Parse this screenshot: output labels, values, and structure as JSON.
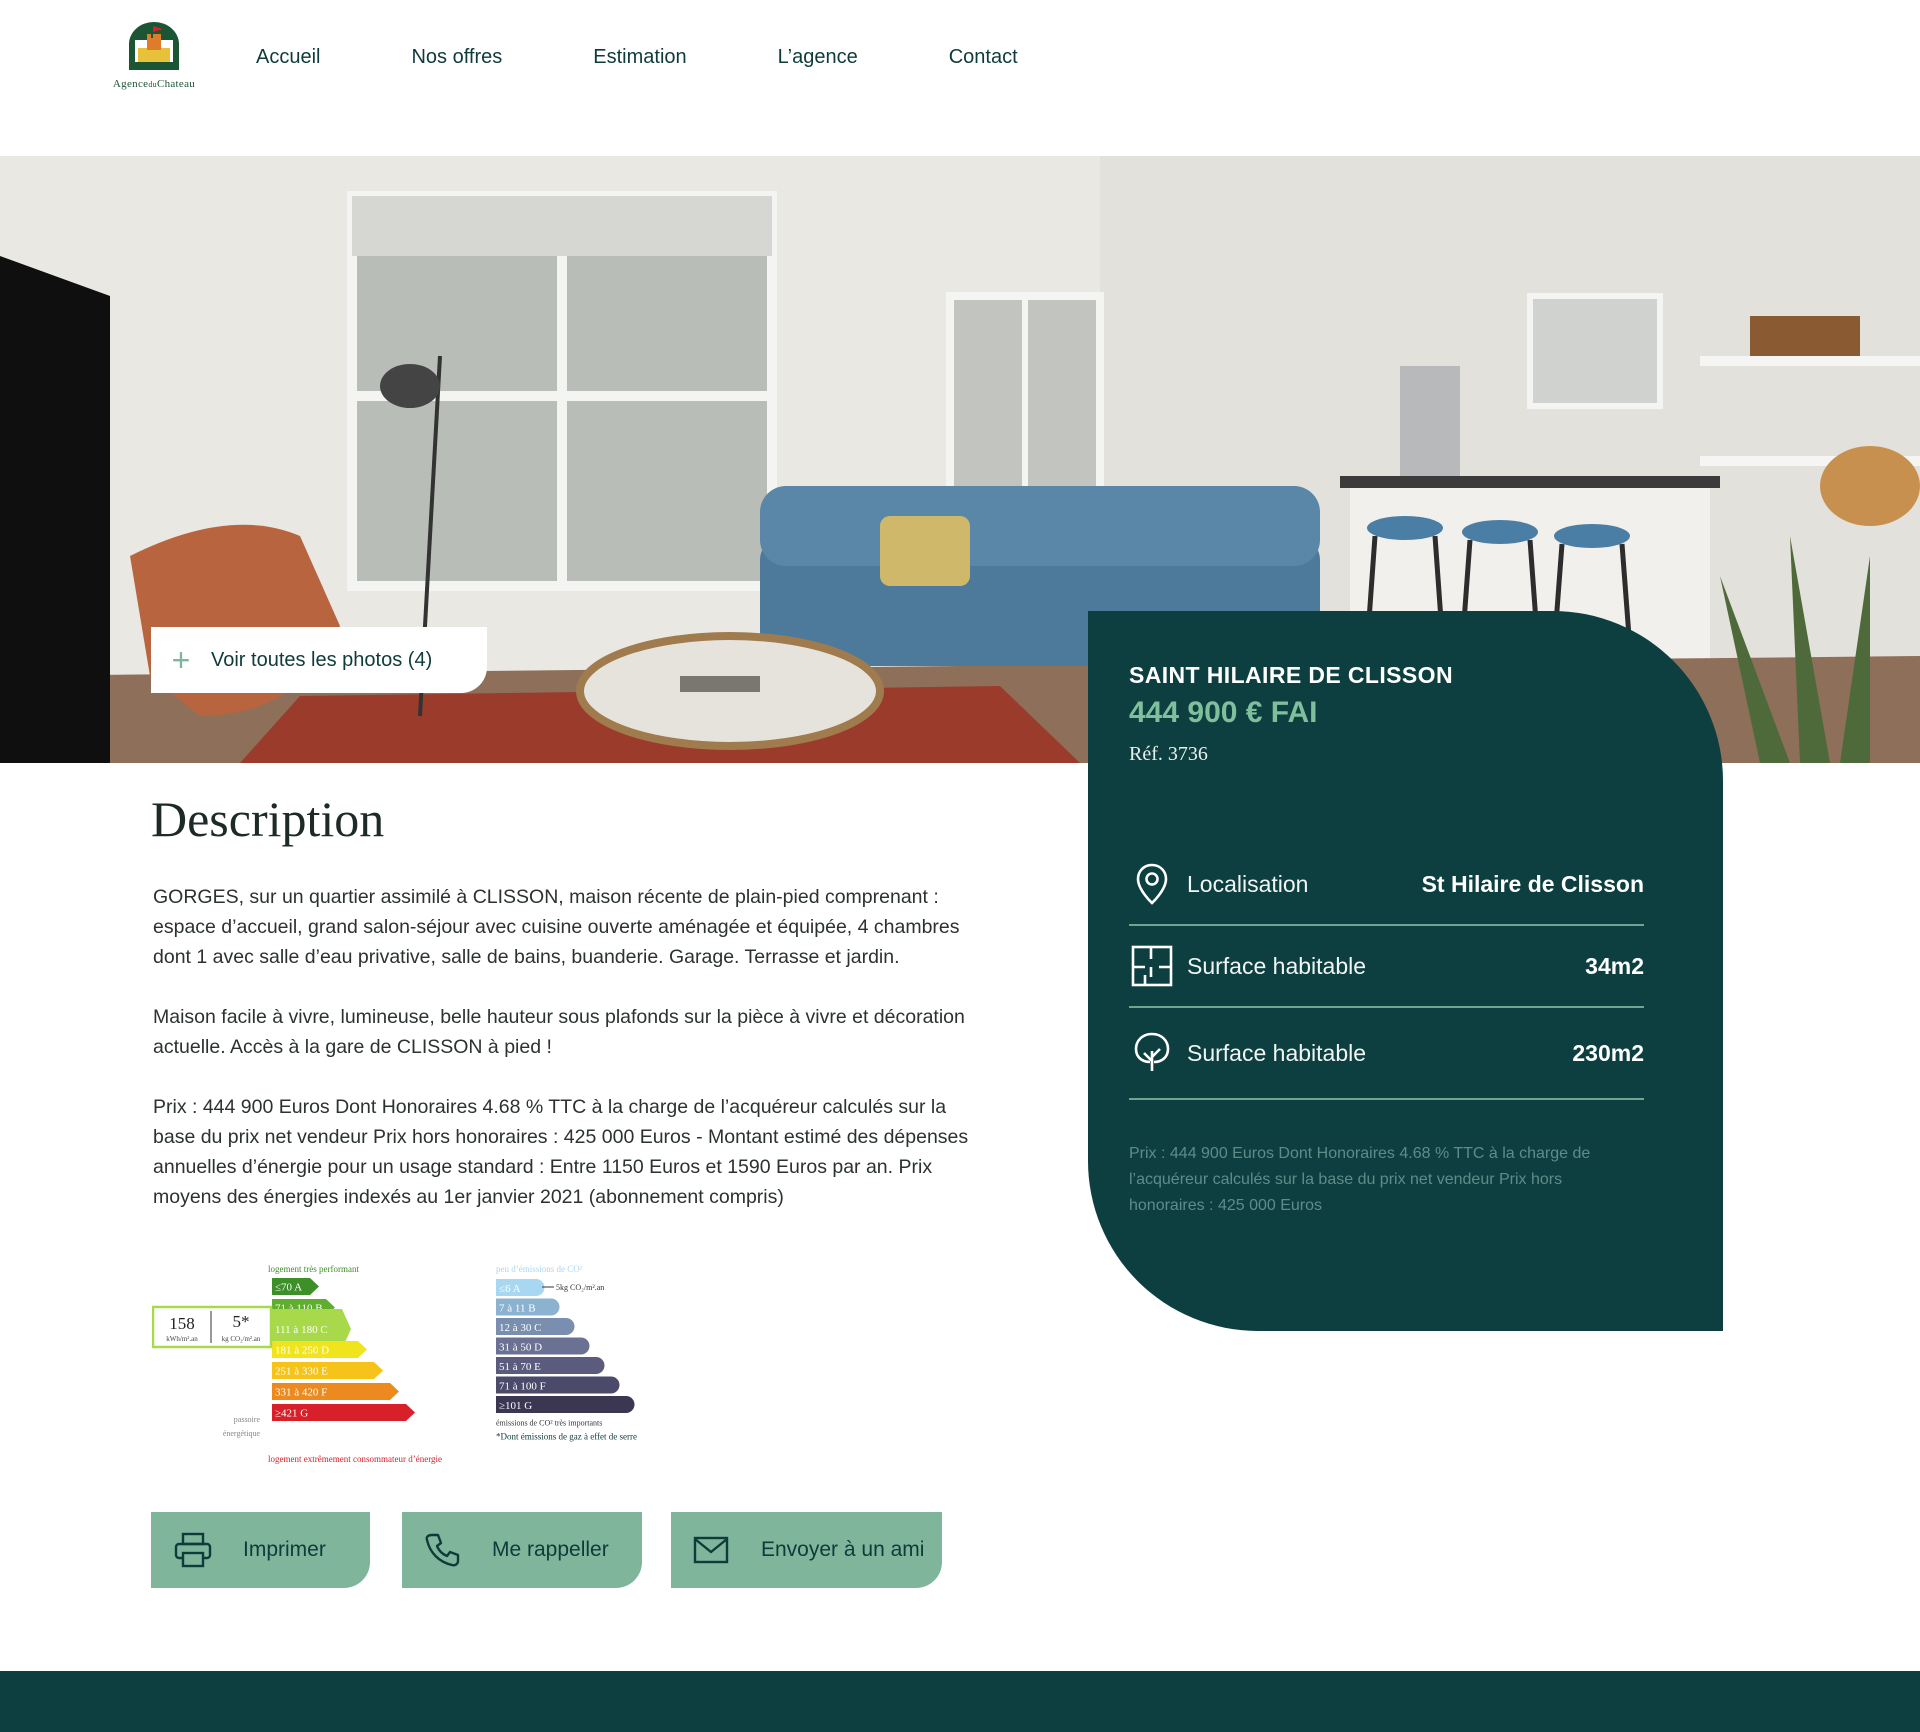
{
  "brand": {
    "name_line": "AGENCE DU CHATEAU",
    "name_main1": "Agence",
    "name_small": "du",
    "name_main2": "Chateau"
  },
  "nav": {
    "items": [
      "Accueil",
      "Nos offres",
      "Estimation",
      "L’agence",
      "Contact"
    ]
  },
  "hero": {
    "photos_button": "Voir toutes les photos (4)"
  },
  "listing": {
    "city": "SAINT HILAIRE DE CLISSON",
    "price": "444 900 € FAI",
    "ref": "Réf. 3736",
    "features": [
      {
        "icon": "location-pin-icon",
        "label": "Localisation",
        "value": "St Hilaire de Clisson"
      },
      {
        "icon": "floor-plan-icon",
        "label": "Surface habitable",
        "value": "34m2"
      },
      {
        "icon": "tree-icon",
        "label": "Surface habitable",
        "value": "230m2"
      }
    ],
    "fee_note": "Prix : 444 900 Euros Dont Honoraires 4.68 % TTC à la charge de l’acquéreur calculés sur la base du prix net vendeur Prix hors honoraires : 425 000 Euros"
  },
  "description": {
    "title": "Description",
    "paragraphs": [
      "GORGES, sur un quartier assimilé à CLISSON, maison récente de plain-pied comprenant : espace d’accueil, grand salon-séjour avec cuisine ouverte aménagée et équipée, 4 chambres dont 1 avec salle d’eau privative, salle de bains, buanderie. Garage. Terrasse et jardin.",
      "Maison facile à vivre, lumineuse, belle hauteur sous plafonds sur la pièce à vivre et décoration actuelle. Accès à la gare de CLISSON à pied !",
      "Prix : 444 900 Euros Dont Honoraires 4.68 % TTC à la charge de l’acquéreur calculés sur la base du prix net vendeur Prix hors honoraires : 425 000 Euros - Montant estimé des dépenses annuelles d’énergie pour un usage standard : Entre 1150 Euros et 1590 Euros par an. Prix moyens des énergies indexés au 1er janvier 2021 (abonnement compris)"
    ]
  },
  "dpe": {
    "energy_top": "logement très performant",
    "energy_bottom": "logement extrêmement consommateur d’énergie",
    "energy_value": "158",
    "energy_unit": "kWh/m².an",
    "ges_value": "5*",
    "ges_unit": "kg CO₂/m².an",
    "passoire": "passoire",
    "energetique": "énergétique",
    "energy_classes": [
      {
        "label": "≤70 A",
        "color": "#3d8f28"
      },
      {
        "label": "71 à 110 B",
        "color": "#5fae2e"
      },
      {
        "label": "111 à 180 C",
        "color": "#a8d94a"
      },
      {
        "label": "181 à 250 D",
        "color": "#f0e51d"
      },
      {
        "label": "251 à 330 E",
        "color": "#f5c31a"
      },
      {
        "label": "331 à 420 F",
        "color": "#ec8a1f"
      },
      {
        "label": "≥421 G",
        "color": "#d8202a"
      }
    ],
    "energy_current_class": "C",
    "ges_top": "peu d’émissions de CO²",
    "ges_bottom": "émissions de CO² très importants",
    "ges_note": "*Dont émissions de gaz à effet de serre",
    "ges_marker": "5kg CO₂/m².an",
    "ges_classes": [
      {
        "label": "≤6 A",
        "color": "#a8d7f1"
      },
      {
        "label": "7 à 11 B",
        "color": "#8bb2cf"
      },
      {
        "label": "12 à 30 C",
        "color": "#7a8fb0"
      },
      {
        "label": "31 à 50 D",
        "color": "#6a7193"
      },
      {
        "label": "51 à 70 E",
        "color": "#5b5b7e"
      },
      {
        "label": "71 à 100 F",
        "color": "#4c4a6a"
      },
      {
        "label": "≥101 G",
        "color": "#3b3752"
      }
    ]
  },
  "actions": {
    "print": "Imprimer",
    "callback": "Me rappeller",
    "send": "Envoyer à un ami"
  },
  "colors": {
    "primary_dark": "#0d3f40",
    "accent_green": "#7fb59a",
    "price_green": "#7fbf9c"
  }
}
